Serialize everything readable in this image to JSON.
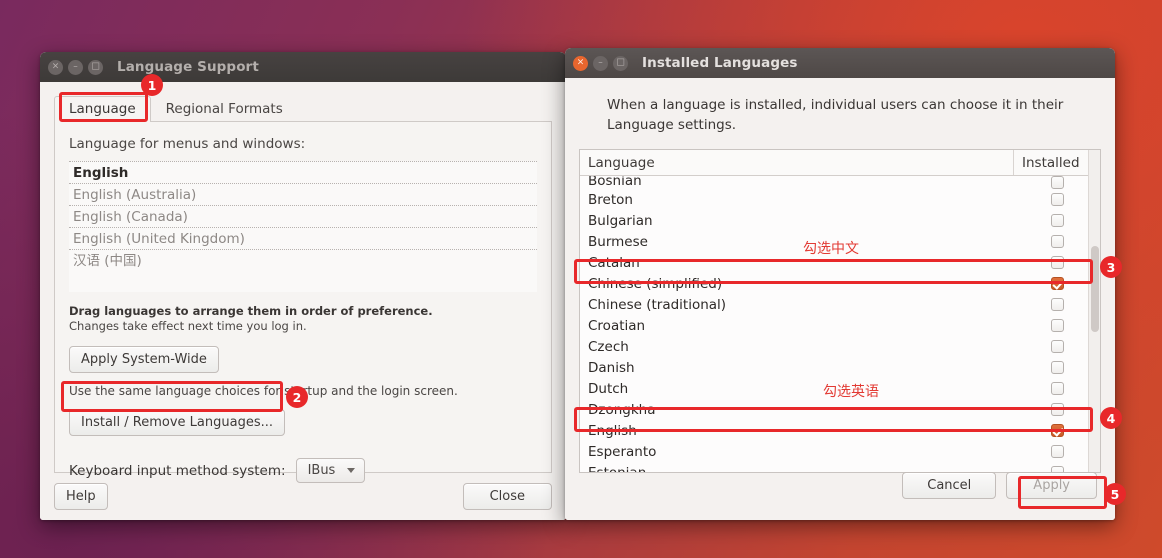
{
  "desktop": {
    "wallpaper_colors": [
      "#792a5e",
      "#a63a41",
      "#cf4a2b"
    ]
  },
  "language_support_window": {
    "title": "Language Support",
    "window_buttons": {
      "close": "×",
      "minimize": "–",
      "maximize": "□"
    },
    "tabs": [
      {
        "label": "Language",
        "active": true
      },
      {
        "label": "Regional Formats",
        "active": false
      }
    ],
    "menus_label": "Language for menus and windows:",
    "language_order": [
      "English",
      "English (Australia)",
      "English (Canada)",
      "English (United Kingdom)",
      "汉语 (中国)"
    ],
    "drag_hint_bold": "Drag languages to arrange them in order of preference.",
    "drag_hint": "Changes take effect next time you log in.",
    "apply_system_wide_label": "Apply System-Wide",
    "same_choices_hint": "Use the same language choices for startup and the login screen.",
    "install_remove_label": "Install / Remove Languages...",
    "keyboard_label": "Keyboard input method system:",
    "keyboard_value": "IBus",
    "help_label": "Help",
    "close_label": "Close"
  },
  "installed_languages_window": {
    "title": "Installed Languages",
    "window_buttons": {
      "close": "×",
      "minimize": "–",
      "maximize": "□"
    },
    "description": "When a language is installed, individual users can choose it in their Language settings.",
    "columns": {
      "language": "Language",
      "installed": "Installed"
    },
    "rows": [
      {
        "language": "Bosnian",
        "installed": false,
        "clipped": true
      },
      {
        "language": "Breton",
        "installed": false
      },
      {
        "language": "Bulgarian",
        "installed": false
      },
      {
        "language": "Burmese",
        "installed": false
      },
      {
        "language": "Catalan",
        "installed": false
      },
      {
        "language": "Chinese (simplified)",
        "installed": true
      },
      {
        "language": "Chinese (traditional)",
        "installed": false
      },
      {
        "language": "Croatian",
        "installed": false
      },
      {
        "language": "Czech",
        "installed": false
      },
      {
        "language": "Danish",
        "installed": false
      },
      {
        "language": "Dutch",
        "installed": false
      },
      {
        "language": "Dzongkha",
        "installed": false
      },
      {
        "language": "English",
        "installed": true
      },
      {
        "language": "Esperanto",
        "installed": false
      },
      {
        "language": "Estonian",
        "installed": false
      }
    ],
    "cancel_label": "Cancel",
    "apply_label": "Apply",
    "apply_disabled": true
  },
  "annotations": {
    "accent_color": "#e8282a",
    "badges": [
      {
        "id": "1",
        "number": "1"
      },
      {
        "id": "2",
        "number": "2"
      },
      {
        "id": "3",
        "number": "3"
      },
      {
        "id": "4",
        "number": "4"
      },
      {
        "id": "5",
        "number": "5"
      }
    ],
    "notes": [
      {
        "id": "note-chinese",
        "text": "勾选中文"
      },
      {
        "id": "note-english",
        "text": "勾选英语"
      }
    ]
  }
}
